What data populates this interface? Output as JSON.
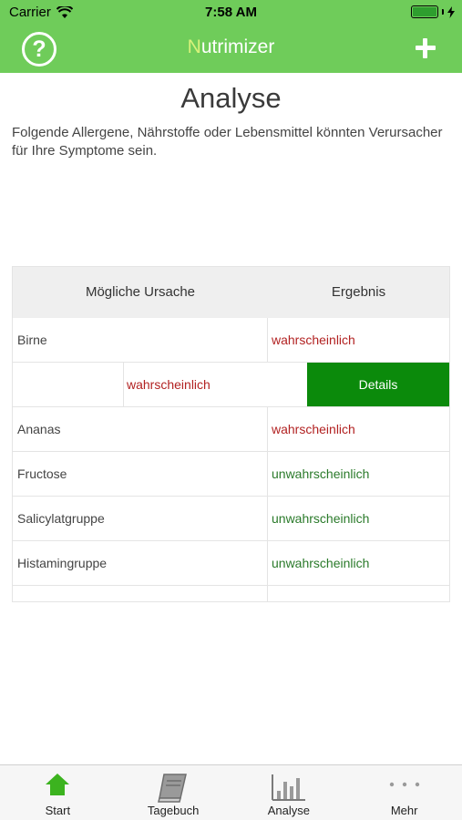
{
  "status_bar": {
    "carrier": "Carrier",
    "time": "7:58 AM"
  },
  "nav": {
    "title_first": "N",
    "title_rest": "utrimizer",
    "help_glyph": "?"
  },
  "page": {
    "title": "Analyse",
    "intro": "Folgende Allergene, Nährstoffe oder Lebensmittel könnten Verursacher für Ihre Symptome sein."
  },
  "table": {
    "headers": [
      "Mögliche Ursache",
      "Ergebnis"
    ],
    "rows": [
      {
        "cause": "Birne",
        "result": "wahrscheinlich"
      },
      {
        "cause": "",
        "result": "wahrscheinlich",
        "action": "Details"
      },
      {
        "cause": "Ananas",
        "result": "wahrscheinlich"
      },
      {
        "cause": "Fructose",
        "result": "unwahrscheinlich"
      },
      {
        "cause": "Salicylatgruppe",
        "result": "unwahrscheinlich"
      },
      {
        "cause": "Histamingruppe",
        "result": "unwahrscheinlich"
      }
    ]
  },
  "colors": {
    "accent": "#6fcc5a",
    "likely": "#b22222",
    "unlikely": "#2a7a2a",
    "details": "#0b8a0b"
  },
  "tabs": [
    {
      "label": "Start",
      "icon": "home-icon"
    },
    {
      "label": "Tagebuch",
      "icon": "book-icon"
    },
    {
      "label": "Analyse",
      "icon": "bar-chart-icon"
    },
    {
      "label": "Mehr",
      "icon": "more-icon"
    }
  ]
}
